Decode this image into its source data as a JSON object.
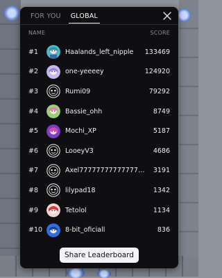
{
  "tabs": [
    {
      "label": "FOR YOU",
      "active": false
    },
    {
      "label": "GLOBAL",
      "active": true
    }
  ],
  "header": {
    "name": "NAME",
    "score": "SCORE"
  },
  "rows": [
    {
      "rank": "#1",
      "name": "Haalands_left_nipple",
      "score": "133469",
      "avatar": "teal-character-avatar"
    },
    {
      "rank": "#2",
      "name": "one-yeeeey",
      "score": "124920",
      "avatar": "purple-character-avatar"
    },
    {
      "rank": "#3",
      "name": "Rumi09",
      "score": "79292",
      "avatar": "default-face-icon"
    },
    {
      "rank": "#4",
      "name": "Bassie_ohh",
      "score": "8749",
      "avatar": "pink-character-avatar"
    },
    {
      "rank": "#5",
      "name": "Mochi_XP",
      "score": "5187",
      "avatar": "magenta-character-avatar"
    },
    {
      "rank": "#6",
      "name": "LooeyV3",
      "score": "4686",
      "avatar": "default-face-icon"
    },
    {
      "rank": "#7",
      "name": "Axel77777777777777777...",
      "score": "3191",
      "avatar": "default-face-icon"
    },
    {
      "rank": "#8",
      "name": "lilypad18",
      "score": "1342",
      "avatar": "default-face-icon"
    },
    {
      "rank": "#9",
      "name": "Tetolol",
      "score": "1134",
      "avatar": "red-character-avatar"
    },
    {
      "rank": "#10",
      "name": "8-bit_oficiall",
      "score": "836",
      "avatar": "blue-character-avatar"
    }
  ],
  "share_label": "Share Leaderboard",
  "colors": {
    "modal_bg": "#0f0f11",
    "button_bg": "#f4f4f6"
  }
}
